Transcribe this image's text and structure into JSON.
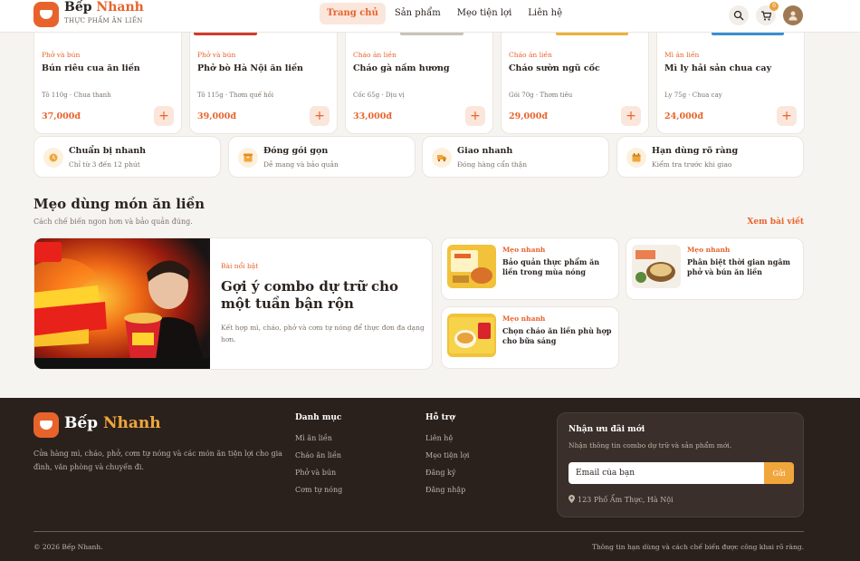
{
  "header": {
    "brand_main": "Bếp",
    "brand_accent": "Nhanh",
    "brand_sub": "Thực phẩm ăn liền",
    "nav": [
      "Trang chủ",
      "Sản phẩm",
      "Mẹo tiện lợi",
      "Liên hệ"
    ],
    "cart_count": "0"
  },
  "products": [
    {
      "category": "Phở và bún",
      "name": "Bún riêu cua ăn liền",
      "meta": "Tô 110g · Chua thanh",
      "price": "37,000đ"
    },
    {
      "category": "Phở và bún",
      "name": "Phở bò Hà Nội ăn liền",
      "meta": "Tô 115g · Thơm quế hồi",
      "price": "39,000đ"
    },
    {
      "category": "Cháo ăn liền",
      "name": "Cháo gà nấm hương",
      "meta": "Cốc 65g · Dịu vị",
      "price": "33,000đ"
    },
    {
      "category": "Cháo ăn liền",
      "name": "Cháo sườn ngũ cốc",
      "meta": "Gói 70g · Thơm tiêu",
      "price": "29,000đ"
    },
    {
      "category": "Mì ăn liền",
      "name": "Mì ly hải sản chua cay",
      "meta": "Ly 75g · Chua cay",
      "price": "24,000đ"
    }
  ],
  "add_symbol": "+",
  "features": [
    {
      "title": "Chuẩn bị nhanh",
      "desc": "Chỉ từ 3 đến 12 phút",
      "icon": "clock-icon"
    },
    {
      "title": "Đóng gói gọn",
      "desc": "Dễ mang và bảo quản",
      "icon": "box-icon"
    },
    {
      "title": "Giao nhanh",
      "desc": "Đóng hàng cẩn thận",
      "icon": "truck-icon"
    },
    {
      "title": "Hạn dùng rõ ràng",
      "desc": "Kiểm tra trước khi giao",
      "icon": "calendar-icon"
    }
  ],
  "tips": {
    "title": "Mẹo dùng món ăn liền",
    "subtitle": "Cách chế biến ngon hơn và bảo quản đúng.",
    "link": "Xem bài viết",
    "featured": {
      "label": "Bài nổi bật",
      "title": "Gợi ý combo dự trữ cho một tuần bận rộn",
      "desc": "Kết hợp mì, cháo, phở và cơm tự nóng để thực đơn đa dạng hơn.",
      "image_text": "MODERN XTREME"
    },
    "items": [
      {
        "label": "Mẹo nhanh",
        "title": "Bảo quản thực phẩm ăn liền trong mùa nóng"
      },
      {
        "label": "Mẹo nhanh",
        "title": "Phân biệt thời gian ngâm phở và bún ăn liền"
      },
      {
        "label": "Mẹo nhanh",
        "title": "Chọn cháo ăn liền phù hợp cho bữa sáng"
      }
    ]
  },
  "footer": {
    "brand_main": "Bếp",
    "brand_accent": "Nhanh",
    "desc": "Cửa hàng mì, cháo, phở, cơm tự nóng và các món ăn tiện lợi cho gia đình, văn phòng và chuyến đi.",
    "col1_title": "Danh mục",
    "col1_links": [
      "Mì ăn liền",
      "Cháo ăn liền",
      "Phở và bún",
      "Cơm tự nóng"
    ],
    "col2_title": "Hỗ trợ",
    "col2_links": [
      "Liên hệ",
      "Mẹo tiện lợi",
      "Đăng ký",
      "Đăng nhập"
    ],
    "newsletter_title": "Nhận ưu đãi mới",
    "newsletter_desc": "Nhận thông tin combo dự trữ và sản phẩm mới.",
    "email_placeholder": "Email của bạn",
    "submit_label": "Gửi",
    "address": "123 Phố Ẩm Thực, Hà Nội",
    "copyright": "© 2026 Bếp Nhanh.",
    "note": "Thông tin hạn dùng và cách chế biến được công khai rõ ràng."
  },
  "colors": {
    "accent": "#e8632b",
    "accent_secondary": "#f1a63c",
    "footer_bg": "#2a211d"
  }
}
